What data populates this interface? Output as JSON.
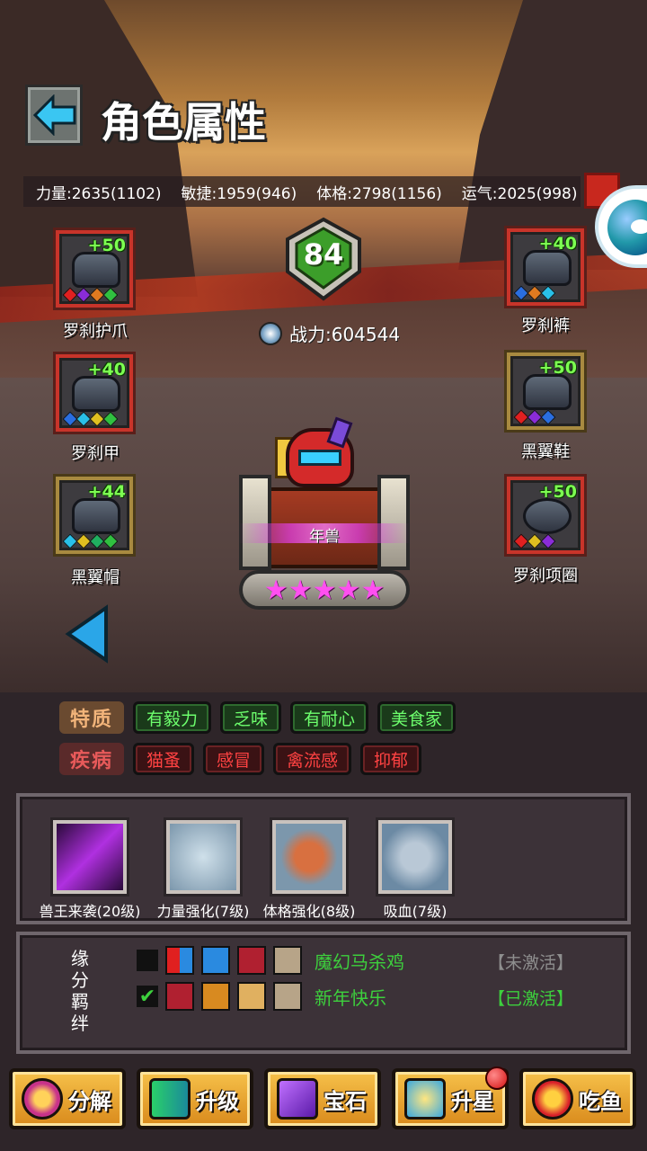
{
  "header": {
    "title": "角色属性"
  },
  "stats": {
    "str": "力量:2635(1102)",
    "agi": "敏捷:1959(946)",
    "con": "体格:2798(1156)",
    "luck": "运气:2025(998)"
  },
  "level": "84",
  "power": "战力:604544",
  "hero_name": "年兽",
  "stars": "★★★★★",
  "equipment": {
    "claw": {
      "plus": "+50",
      "label": "罗刹护爪"
    },
    "armor": {
      "plus": "+40",
      "label": "罗刹甲"
    },
    "hat": {
      "plus": "+44",
      "label": "黑翼帽"
    },
    "pants": {
      "plus": "+40",
      "label": "罗刹裤"
    },
    "shoes": {
      "plus": "+50",
      "label": "黑翼鞋"
    },
    "necklace": {
      "plus": "+50",
      "label": "罗刹项圈"
    }
  },
  "traits": {
    "label": "特质",
    "items": [
      "有毅力",
      "乏味",
      "有耐心",
      "美食家"
    ]
  },
  "diseases": {
    "label": "疾病",
    "items": [
      "猫蚤",
      "感冒",
      "禽流感",
      "抑郁"
    ]
  },
  "skills": [
    "兽王来袭(20级)",
    "力量强化(7级)",
    "体格强化(8级)",
    "吸血(7级)"
  ],
  "bonds": {
    "label_chars": [
      "缘",
      "分",
      "羁",
      "绊"
    ],
    "items": [
      {
        "check": "",
        "name": "魔幻马杀鸡",
        "state": "【未激活】"
      },
      {
        "check": "✔",
        "name": "新年快乐",
        "state": "【已激活】"
      }
    ]
  },
  "buttons": {
    "decompose": "分解",
    "upgrade": "升级",
    "gem": "宝石",
    "starup": "升星",
    "eatfish": "吃鱼"
  },
  "colors": {
    "good": "#6dff6d",
    "bad": "#ff4242",
    "bond_active": "#3dd03d",
    "bond_inactive": "#8e8e8e",
    "plus": "#7dff52",
    "star": "#ff4ff0"
  }
}
